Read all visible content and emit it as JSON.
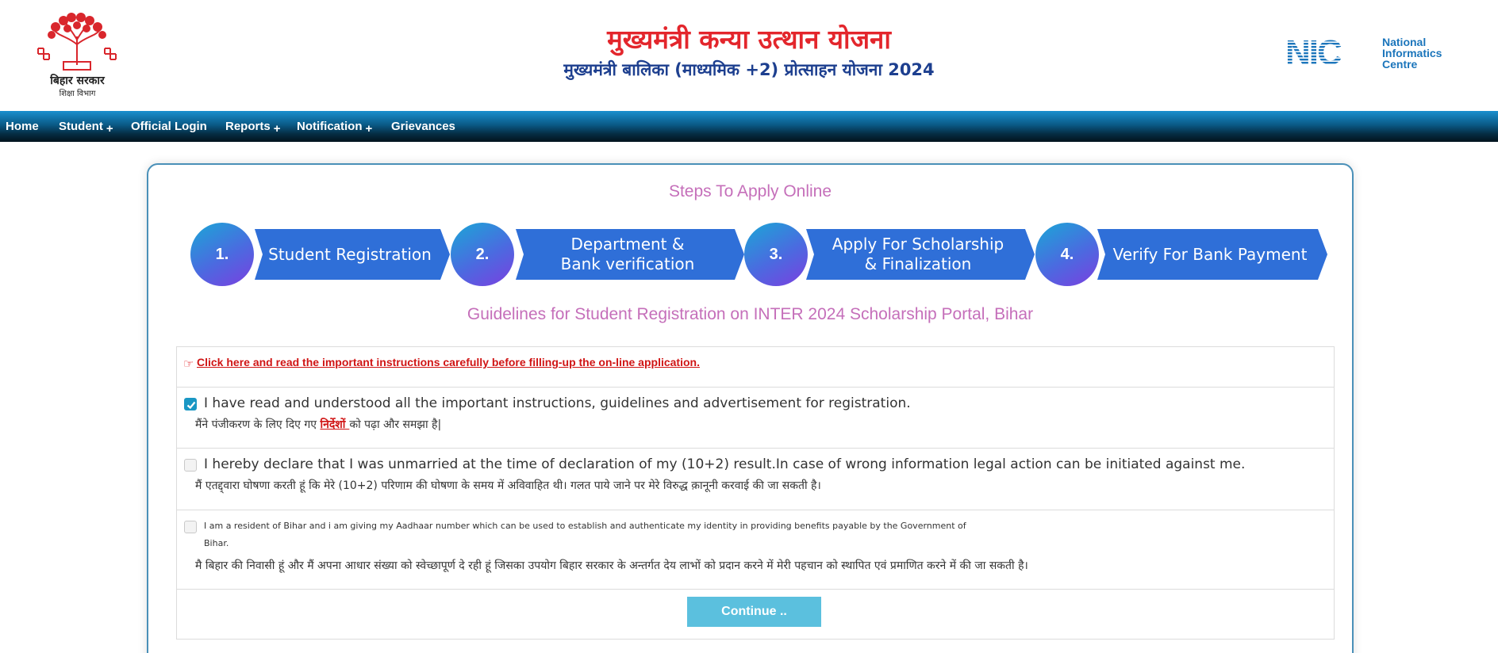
{
  "header": {
    "govt_name": "बिहार सरकार",
    "dept_name": "शिक्षा विभाग",
    "title_main": "मुख्यमंत्री कन्या उत्थान योजना",
    "title_sub": "मुख्यमंत्री बालिका (माध्यमिक +2) प्रोत्साहन योजना 2024",
    "nic_line1": "National",
    "nic_line2": "Informatics",
    "nic_line3": "Centre",
    "nic_logo": "NIC"
  },
  "nav": {
    "items": [
      {
        "label": "Home",
        "has_submenu": false
      },
      {
        "label": "Student",
        "has_submenu": true
      },
      {
        "label": "Official Login",
        "has_submenu": false
      },
      {
        "label": "Reports",
        "has_submenu": true
      },
      {
        "label": "Notification",
        "has_submenu": true
      },
      {
        "label": "Grievances",
        "has_submenu": false
      }
    ],
    "submenu_glyph": "+"
  },
  "steps": {
    "title": "Steps To Apply Online",
    "items": [
      {
        "number": "1.",
        "label_line1": "Student Registration",
        "label_line2": ""
      },
      {
        "number": "2.",
        "label_line1": "Department &",
        "label_line2": "Bank verification"
      },
      {
        "number": "3.",
        "label_line1": "Apply For Scholarship",
        "label_line2": "& Finalization"
      },
      {
        "number": "4.",
        "label_line1": "Verify For Bank Payment",
        "label_line2": ""
      }
    ]
  },
  "guidelines": {
    "title": "Guidelines for Student Registration on INTER 2024 Scholarship Portal, Bihar",
    "instructions_link": "Click here and read the important instructions carefully before filling-up the on-line application.",
    "declarations": [
      {
        "checked": true,
        "english": "I have read and understood all the important instructions, guidelines and advertisement for registration.",
        "hindi_before": "मैंने पंजीकरण के लिए दिए गए ",
        "hindi_link": "निर्देशों ",
        "hindi_after": "को पढ़ा और समझा है|"
      },
      {
        "checked": false,
        "english": "I hereby declare that I was unmarried at the time of declaration of my (10+2) result.In case of wrong information legal action can be initiated against me.",
        "hindi": "मैं एतद्द्वारा घोषणा करती हूं कि मेरे (10+2) परिणाम की घोषणा के समय में अविवाहित थी। गलत पाये जाने पर मेरे विरुद्ध क़ानूनी करवाई की जा सकती है।"
      },
      {
        "checked": false,
        "english_line1": "I am a resident of Bihar and i am giving my Aadhaar number which can be used to establish and authenticate my identity in providing benefits payable by the Government of",
        "english_line2": "Bihar.",
        "hindi": "मै बिहार की निवासी हूं और मैं अपना आधार संख्या को स्वेच्छापूर्ण दे रही हूं जिसका उपयोग बिहार सरकार के अन्तर्गत देय लाभों को प्रदान करने में मेरी पहचान को स्थापित एवं प्रमाणित करने में की जा सकती है।"
      }
    ],
    "continue_label": "Continue .."
  },
  "colors": {
    "title_red": "#e3262c",
    "title_blue": "#1d3f8f",
    "step_blue": "#2f6fd8",
    "heading_pink": "#c56fba",
    "button_cyan": "#5bc0de",
    "link_red": "#d01515"
  }
}
